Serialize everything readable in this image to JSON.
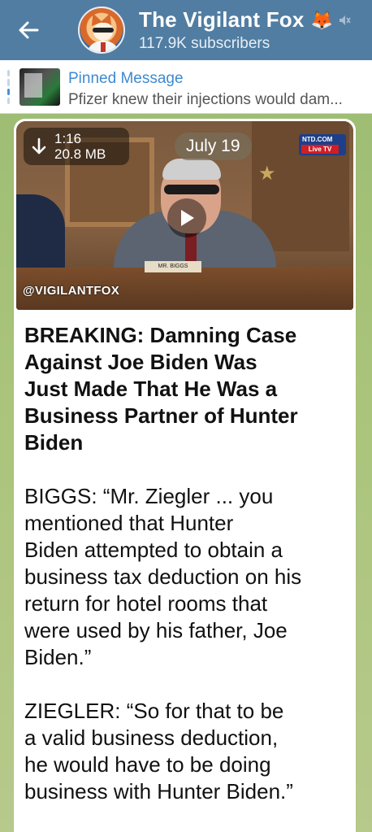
{
  "header": {
    "back_icon": "arrow-left-icon",
    "channel_title": "The Vigilant Fox",
    "title_emoji": "🦊",
    "muted_icon": "muted-speaker-icon",
    "subscribers": "117.9K subscribers",
    "background_color": "#517da2"
  },
  "pinned": {
    "title": "Pinned Message",
    "preview": "Pfizer knew their injections would dam..."
  },
  "message": {
    "video": {
      "duration": "1:16",
      "size": "20.8 MB",
      "download_icon": "download-arrow-icon",
      "date_badge": "July 19",
      "channel_logo_top": "NTD.COM",
      "channel_logo_bottom": "Live TV",
      "nameplate": "MR. BIGGS",
      "watermark": "@VIGILANTFOX",
      "play_icon": "play-icon"
    },
    "headline": "BREAKING: Damning Case\nAgainst Joe Biden Was\nJust Made That He Was a\nBusiness Partner of Hunter\nBiden",
    "paragraph_1": "BIGGS: “Mr. Ziegler ... you\nmentioned that Hunter\nBiden attempted to obtain a\nbusiness tax deduction on his\nreturn for hotel rooms that\nwere used by his father, Joe\nBiden.”",
    "paragraph_2": "ZIEGLER: “So for that to be\na valid business deduction,\nhe would have to be doing\nbusiness with Hunter Biden.”"
  }
}
